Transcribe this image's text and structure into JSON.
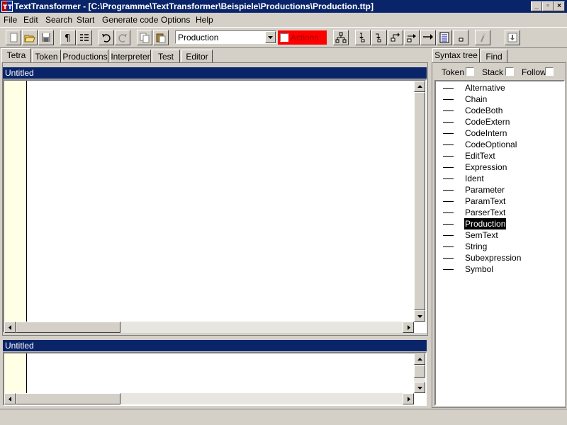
{
  "window": {
    "title": "TextTransformer - [C:\\Programme\\TextTransformer\\Beispiele\\Productions\\Production.ttp]"
  },
  "menu": [
    "File",
    "Edit",
    "Search",
    "Start",
    "Generate code",
    "Options",
    "Help"
  ],
  "toolbar": {
    "production_combo_value": "Production",
    "actions_label": "Actions",
    "actions_checked": false,
    "icons": [
      "new-icon",
      "open-icon",
      "save-icon",
      "paragraph-icon",
      "list-icon",
      "undo-icon",
      "redo-icon",
      "copy-icon",
      "paste-icon",
      "tree-icon",
      "step-into-icon",
      "step-over-icon",
      "step-out-icon",
      "run-to-icon",
      "go-icon",
      "breakpoints-icon",
      "stop-icon",
      "wand-icon",
      "export-icon"
    ]
  },
  "left_tabs": [
    "Tetra",
    "Token",
    "Productions",
    "Interpreter",
    "Test",
    "Editor"
  ],
  "left_active_tab": "Tetra",
  "editor_top": {
    "caption": "Untitled"
  },
  "editor_bottom": {
    "caption": "Untitled"
  },
  "right_tabs": [
    "Syntax tree",
    "Find"
  ],
  "right_active_tab": "Syntax tree",
  "right_options": {
    "token_label": "Token",
    "stack_label": "Stack",
    "follow_label": "Follow"
  },
  "tree_items": [
    "Alternative",
    "Chain",
    "CodeBoth",
    "CodeExtern",
    "CodeIntern",
    "CodeOptional",
    "EditText",
    "Expression",
    "Ident",
    "Parameter",
    "ParamText",
    "ParserText",
    "Production",
    "SemText",
    "String",
    "Subexpression",
    "Symbol"
  ],
  "tree_selected": "Production",
  "colors": {
    "titlebar": "#0a246a",
    "face": "#d4d0c8",
    "gutter": "#ffffe6",
    "actions": "#ff0000"
  }
}
